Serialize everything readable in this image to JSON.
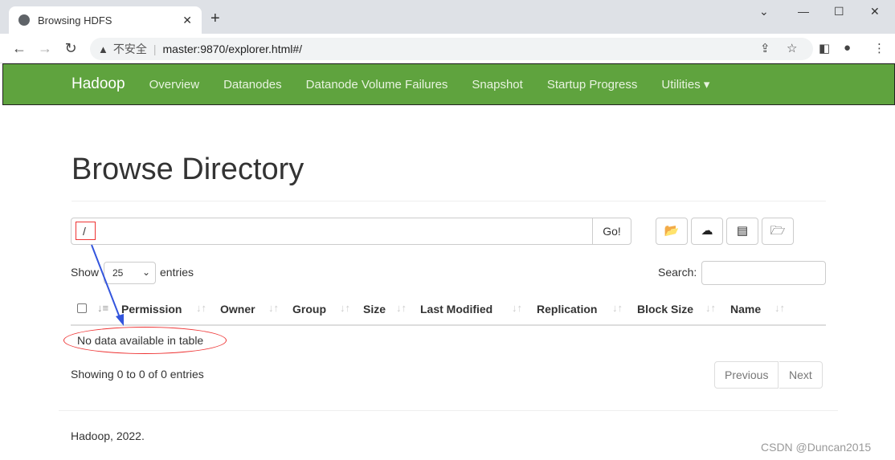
{
  "browser": {
    "tab_title": "Browsing HDFS",
    "insecure_label": "不安全",
    "url": "master:9870/explorer.html#/"
  },
  "navbar": {
    "brand": "Hadoop",
    "items": [
      "Overview",
      "Datanodes",
      "Datanode Volume Failures",
      "Snapshot",
      "Startup Progress",
      "Utilities ▾"
    ],
    "color": "#5fa33e"
  },
  "page": {
    "title": "Browse Directory",
    "path_value": "/",
    "go_label": "Go!",
    "toolbar_icons": [
      "folder-open-icon",
      "cloud-upload-icon",
      "list-alt-icon",
      "folder-create-icon"
    ],
    "show_label": "Show",
    "entries_value": "25",
    "entries_label": "entries",
    "search_label": "Search:",
    "columns": [
      "Permission",
      "Owner",
      "Group",
      "Size",
      "Last Modified",
      "Replication",
      "Block Size",
      "Name"
    ],
    "empty_message": "No data available in table",
    "info": "Showing 0 to 0 of 0 entries",
    "prev": "Previous",
    "next": "Next"
  },
  "footer": "Hadoop, 2022.",
  "watermark": "CSDN @Duncan2015"
}
